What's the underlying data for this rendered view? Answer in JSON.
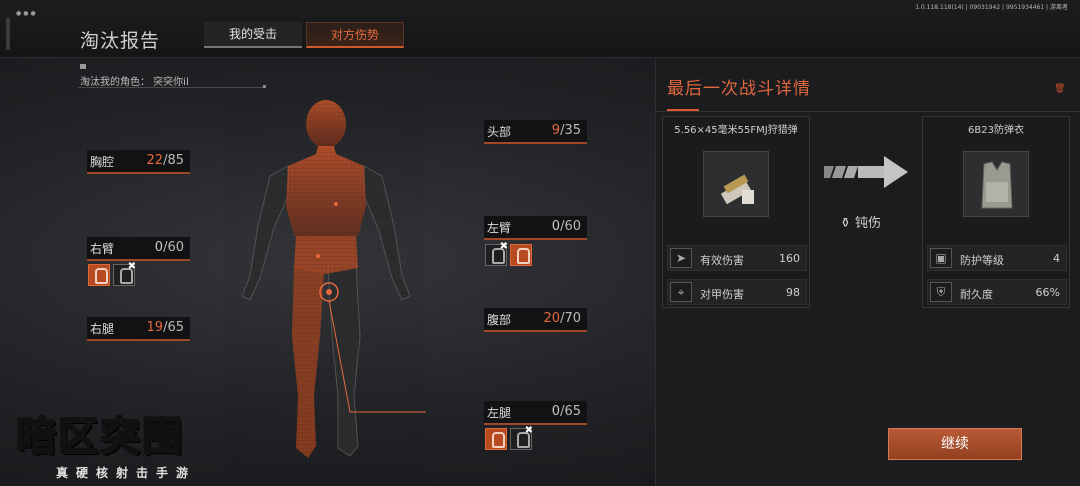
{
  "header": {
    "version_info": "1.0.118.118(14) | 09031942 | 9951934461 | 游离者",
    "page_title": "淘汰报告",
    "tabs": [
      {
        "label": "我的受击",
        "active": false
      },
      {
        "label": "对方伤势",
        "active": true
      }
    ]
  },
  "victim_label": "淘汰我的角色： 突突你il",
  "body_parts": {
    "chest": {
      "name": "胸腔",
      "current": "22",
      "max": "/85"
    },
    "right_arm": {
      "name": "右臂",
      "current": "0",
      "max": "/60"
    },
    "right_leg": {
      "name": "右腿",
      "current": "19",
      "max": "/65"
    },
    "head": {
      "name": "头部",
      "current": "9",
      "max": "/35"
    },
    "left_arm": {
      "name": "左臂",
      "current": "0",
      "max": "/60"
    },
    "abdomen": {
      "name": "腹部",
      "current": "20",
      "max": "/70"
    },
    "left_leg": {
      "name": "左腿",
      "current": "0",
      "max": "/65"
    }
  },
  "last_fight": {
    "title": "最后一次战斗详情",
    "ammo": {
      "name": "5.56×45毫米55FMJ狩猎弹",
      "stats": [
        {
          "label": "有效伤害",
          "value": "160",
          "icon": "bullet-icon"
        },
        {
          "label": "对甲伤害",
          "value": "98",
          "icon": "crosshair-icon"
        }
      ]
    },
    "damage_type": "钝伤",
    "armor": {
      "name": "6B23防弹衣",
      "stats": [
        {
          "label": "防护等级",
          "value": "4",
          "icon": "vest-icon"
        },
        {
          "label": "耐久度",
          "value": "66%",
          "icon": "durability-icon"
        }
      ]
    }
  },
  "continue_label": "继续",
  "logo": {
    "main": "暗区突围",
    "sub": "真硬核射击手游"
  },
  "colors": {
    "accent": "#e5693e",
    "button": "#a84c2a"
  }
}
